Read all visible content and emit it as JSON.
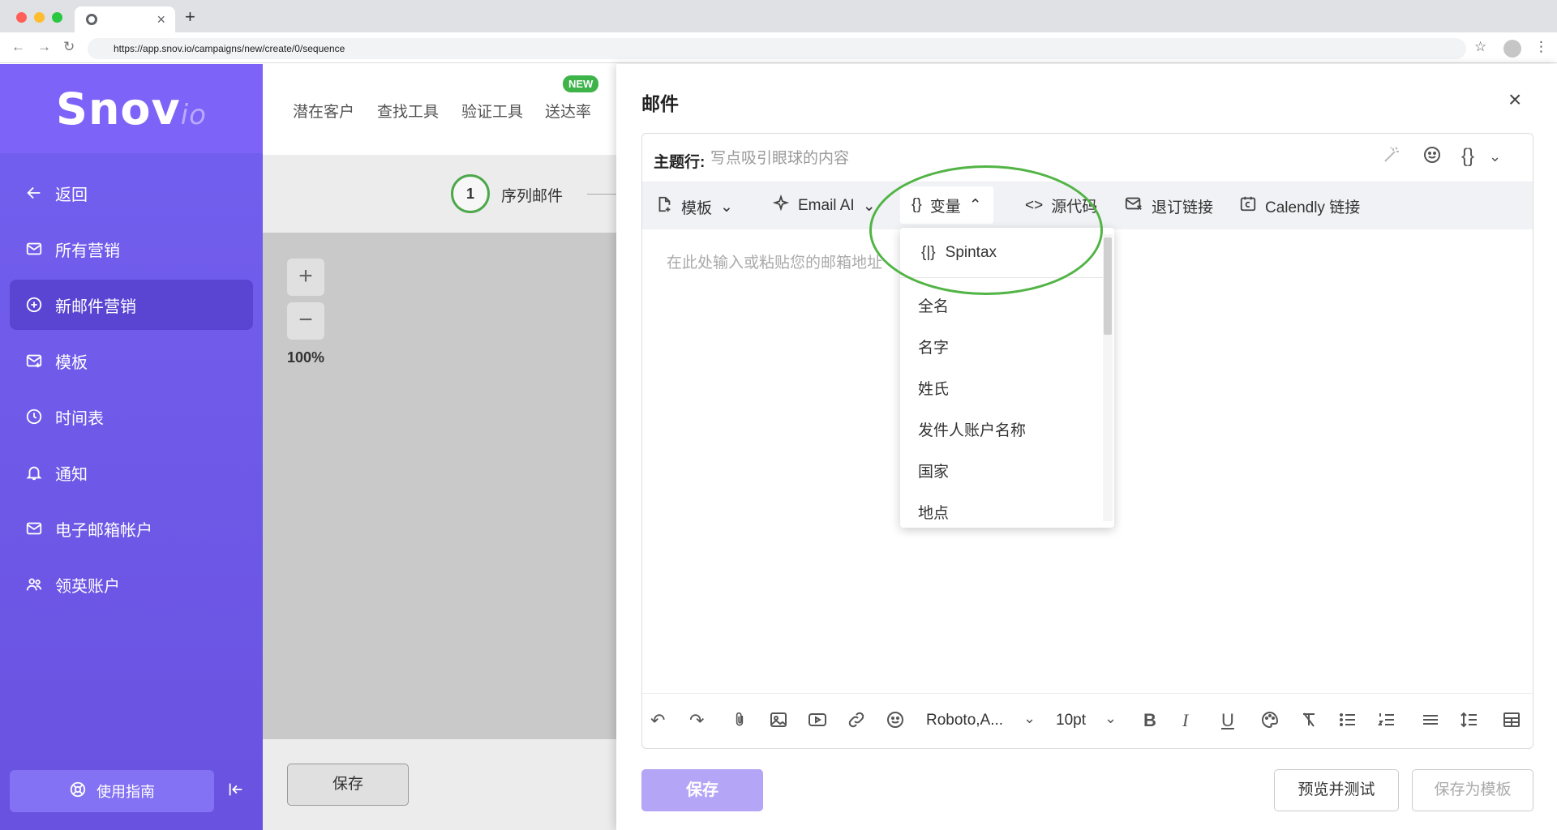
{
  "browser": {
    "url": "https://app.snov.io/campaigns/new/create/0/sequence",
    "tab_close": "×",
    "new_tab": "+"
  },
  "colors": {
    "sidebar": "#7360f0",
    "sidebar_active": "#5a44d2",
    "accent_green": "#52b445",
    "save_button_disabled": "#b5a5f6",
    "new_badge": "#3db34a"
  },
  "logo": {
    "main": "Snov",
    "suffix": "io"
  },
  "sidebar": {
    "items": [
      {
        "label": "返回",
        "icon": "arrow-left-icon"
      },
      {
        "label": "所有营销",
        "icon": "mail-icon"
      },
      {
        "label": "新邮件营销",
        "icon": "plus-circle-icon",
        "active": true
      },
      {
        "label": "模板",
        "icon": "mail-template-icon"
      },
      {
        "label": "时间表",
        "icon": "clock-icon"
      },
      {
        "label": "通知",
        "icon": "bell-icon"
      },
      {
        "label": "电子邮箱帐户",
        "icon": "mail-icon"
      },
      {
        "label": "领英账户",
        "icon": "users-icon"
      }
    ],
    "guide_label": "使用指南",
    "collapse_icon": "collapse-left-icon"
  },
  "topnav": {
    "links": [
      "潜在客户",
      "查找工具",
      "验证工具",
      "送达率"
    ],
    "badge": "NEW"
  },
  "sequence": {
    "step_number": "1",
    "step_label": "序列邮件",
    "zoom_in": "+",
    "zoom_out": "−",
    "zoom_level": "100%",
    "save_label": "保存"
  },
  "email_panel": {
    "title": "邮件",
    "close": "×",
    "subject_label": "主题行:",
    "subject_placeholder": "写点吸引眼球的内容",
    "toolbar": {
      "template": "模板",
      "email_ai": "Email AI",
      "variables": "变量",
      "source_code": "源代码",
      "unsubscribe": "退订链接",
      "calendly": "Calendly 链接"
    },
    "body_placeholder": "在此处输入或粘贴您的邮箱地址",
    "format_bar": {
      "font": "Roboto,A...",
      "size": "10pt"
    },
    "buttons": {
      "save": "保存",
      "preview": "预览并测试",
      "save_as_template": "保存为模板"
    }
  },
  "variables_dropdown": {
    "spintax": "Spintax",
    "items": [
      "全名",
      "名字",
      "姓氏",
      "发件人账户名称",
      "国家",
      "地点"
    ]
  }
}
